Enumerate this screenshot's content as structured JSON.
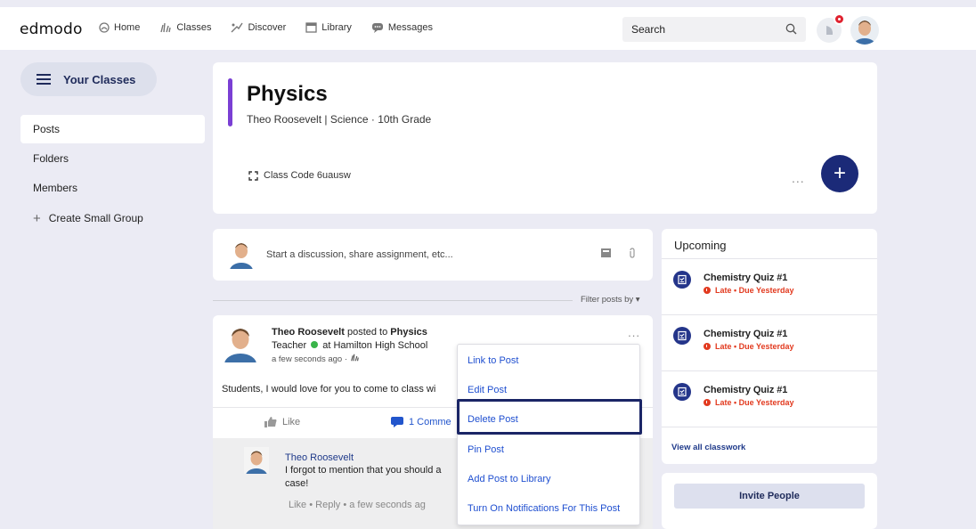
{
  "brand": {
    "logo": "edmodo"
  },
  "nav": {
    "items": [
      {
        "label": "Home",
        "icon": "home-icon"
      },
      {
        "label": "Classes",
        "icon": "classes-icon"
      },
      {
        "label": "Discover",
        "icon": "discover-icon"
      },
      {
        "label": "Library",
        "icon": "library-icon"
      },
      {
        "label": "Messages",
        "icon": "messages-icon"
      }
    ],
    "search_placeholder": "Search"
  },
  "sidebar": {
    "your_classes_label": "Your Classes",
    "items": [
      {
        "label": "Posts",
        "active": true
      },
      {
        "label": "Folders",
        "active": false
      },
      {
        "label": "Members",
        "active": false
      },
      {
        "label": "Create Small Group",
        "active": false
      }
    ]
  },
  "class": {
    "title": "Physics",
    "subtitle": "Theo Roosevelt | Science  · 10th Grade",
    "code_label": "Class Code 6uausw",
    "more": "...",
    "accent_color": "#7a3fd4"
  },
  "composer": {
    "placeholder": "Start a discussion, share assignment, etc..."
  },
  "filter": {
    "label": "Filter posts by ▾"
  },
  "post": {
    "author": "Theo Roosevelt",
    "posted_to_text": " posted to ",
    "target": "Physics",
    "role": "Teacher",
    "school": " at Hamilton High School",
    "time": "a few seconds ago ·",
    "body": "Students, I would love for you to come to class wi",
    "more": "...",
    "like_label": "Like",
    "comments_label": "1 Comme"
  },
  "comment": {
    "author": "Theo Roosevelt",
    "text_line1": "I forgot to mention that you should a",
    "text_line2": "case!",
    "meta": "Like  •  Reply  •  a few seconds ag"
  },
  "post_menu": {
    "items": [
      "Link to Post",
      "Edit Post",
      "Delete Post",
      "Pin Post",
      "Add Post to Library",
      "Turn On Notifications For This Post"
    ],
    "highlighted": "Delete Post"
  },
  "upcoming": {
    "title": "Upcoming",
    "items": [
      {
        "name": "Chemistry Quiz #1",
        "status": "Late • Due Yesterday"
      },
      {
        "name": "Chemistry Quiz #1",
        "status": "Late • Due Yesterday"
      },
      {
        "name": "Chemistry Quiz #1",
        "status": "Late • Due Yesterday"
      }
    ],
    "view_all": "View all classwork"
  },
  "invite": {
    "label": "Invite People"
  },
  "colors": {
    "primary_navy": "#1b2a78",
    "link_blue": "#1f4fd0",
    "late_red": "#e23a1f",
    "background": "#ebebf4"
  }
}
